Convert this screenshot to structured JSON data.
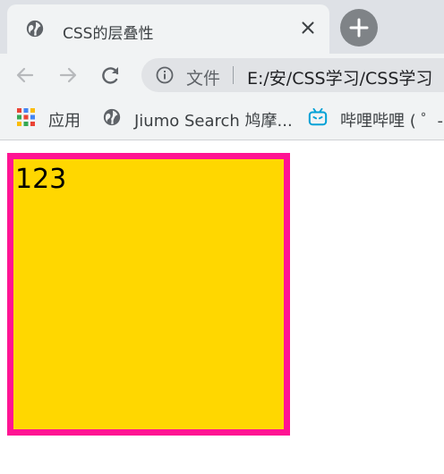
{
  "tab": {
    "title": "CSS的层叠性",
    "favicon": "globe-icon",
    "close": "close-icon"
  },
  "newtab": {
    "icon": "plus-icon"
  },
  "toolbar": {
    "back": "arrow-left-icon",
    "forward": "arrow-right-icon",
    "reload": "reload-icon"
  },
  "omnibox": {
    "info_icon": "info-icon",
    "label": "文件",
    "url": "E:/安/CSS学习/CSS学习"
  },
  "bookmarks": [
    {
      "label": "应用",
      "icon": "apps-grid-icon"
    },
    {
      "label": "Jiumo Search 鸠摩...",
      "icon": "globe-icon"
    },
    {
      "label": "哔哩哔哩 ( ゜-",
      "icon": "bilibili-icon"
    }
  ],
  "page": {
    "box_text": "123"
  },
  "colors": {
    "box_bg": "#ffd700",
    "box_border": "#ff1493"
  }
}
